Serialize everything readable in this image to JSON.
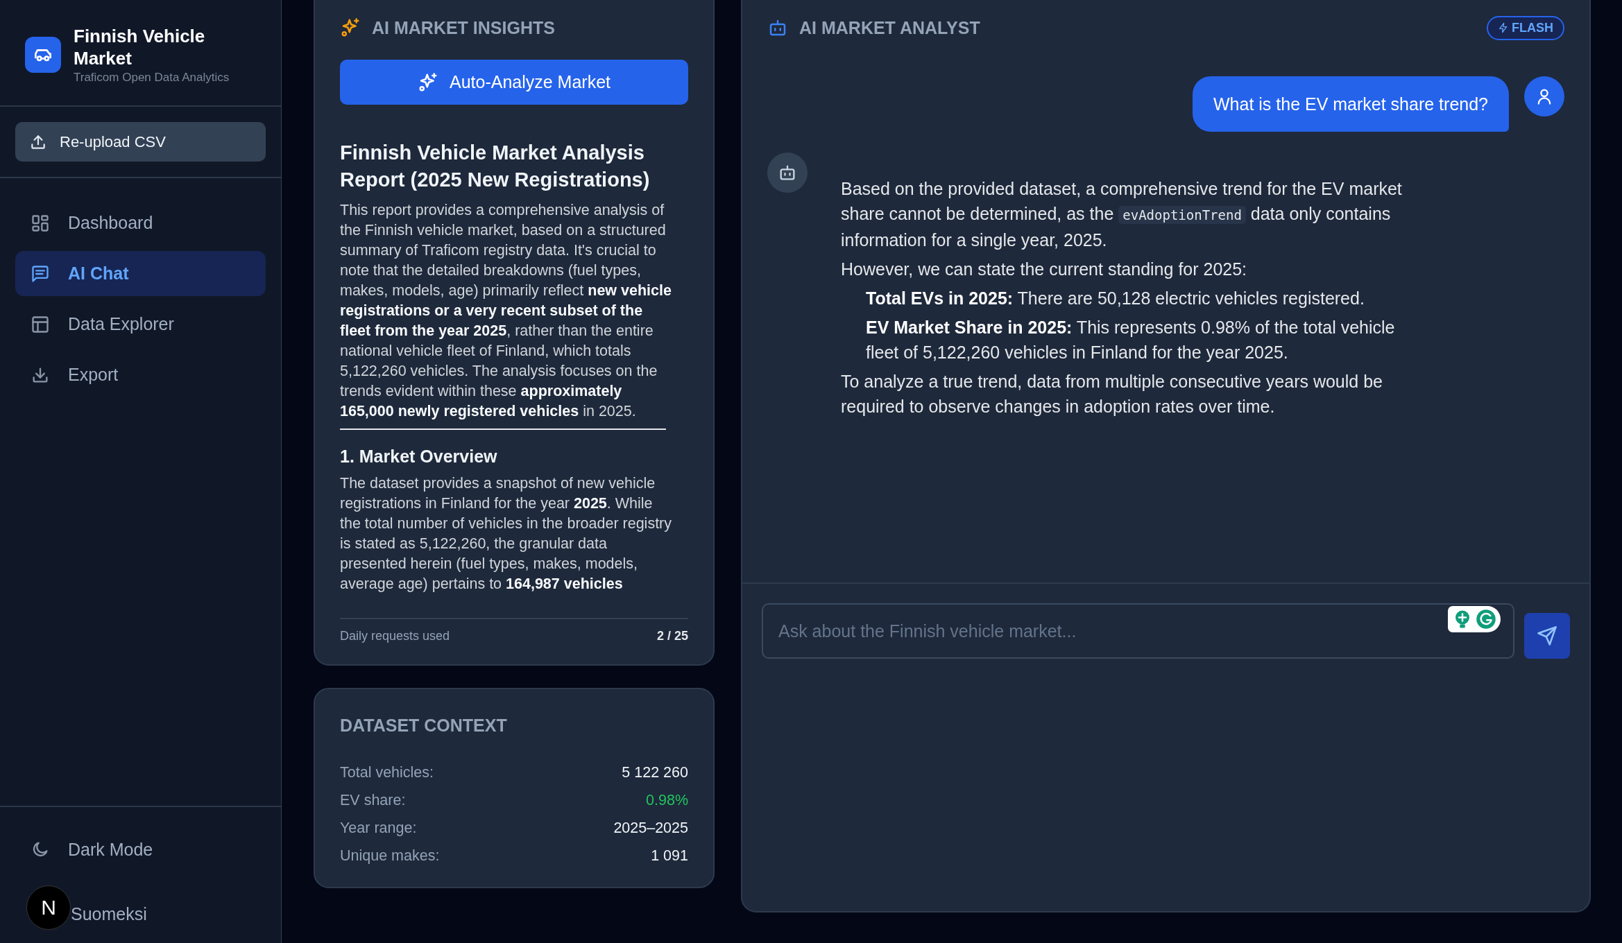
{
  "sidebar": {
    "app_title": "Finnish Vehicle Market",
    "app_subtitle": "Traficom Open Data Analytics",
    "upload_button": "Re-upload CSV",
    "nav_items": [
      {
        "label": "Dashboard",
        "selected": false
      },
      {
        "label": "AI Chat",
        "selected": true
      },
      {
        "label": "Data Explorer",
        "selected": false
      },
      {
        "label": "Export",
        "selected": false
      }
    ],
    "footer_items": [
      {
        "label": "Dark Mode"
      },
      {
        "label": "Suomeksi"
      }
    ]
  },
  "dev_badge": {
    "label": "N"
  },
  "insights": {
    "title": "AI MARKET INSIGHTS",
    "analyze_button": "Auto-Analyze Market",
    "report": [
      {
        "kind": "title",
        "text": "Finnish Vehicle Market Analysis Report (2025 New Registrations)"
      },
      {
        "kind": "paragraph",
        "text": "This report provides a comprehensive analysis of the Finnish vehicle market, based on a structured summary of Traficom registry data. It's crucial to note that the detailed breakdowns (fuel types, makes, models, age) primarily reflect **new vehicle registrations or a very recent subset of the fleet from the year 2025**, rather than the entire national vehicle fleet of Finland, which totals 5,122,260 vehicles. The analysis focuses on the trends evident within these **approximately 165,000 newly registered vehicles** in 2025."
      },
      {
        "kind": "rule"
      },
      {
        "kind": "heading",
        "text": "1. Market Overview"
      },
      {
        "kind": "paragraph",
        "text": "The dataset provides a snapshot of new vehicle registrations in Finland for the year **2025**. While the total number of vehicles in the broader registry is stated as 5,122,260, the granular data presented herein (fuel types, makes, models, average age) pertains to **164,987 vehicles**"
      }
    ],
    "usage_label": "Daily requests used",
    "usage_value": "2 / 25"
  },
  "dataset_context": {
    "title": "DATASET CONTEXT",
    "rows": [
      {
        "label": "Total vehicles:",
        "value": "5 122 260",
        "highlighted": false
      },
      {
        "label": "EV share:",
        "value": "0.98%",
        "highlighted": true
      },
      {
        "label": "Year range:",
        "value": "2025–2025",
        "highlighted": false
      },
      {
        "label": "Unique makes:",
        "value": "1 091",
        "highlighted": false
      }
    ]
  },
  "chat": {
    "title": "AI MARKET ANALYST",
    "mode_badge": "FLASH",
    "messages": [
      {
        "kind": "user",
        "text": "What is the EV market share trend?"
      },
      {
        "kind": "assistant",
        "blocks": [
          {
            "kind": "paragraph",
            "parts": [
              {
                "kind": "text",
                "text": "Based on the provided dataset, a comprehensive trend for the EV market share cannot be determined, as the "
              },
              {
                "kind": "code",
                "text": "evAdoptionTrend"
              },
              {
                "kind": "text",
                "text": " data only contains information for a single year, 2025."
              }
            ]
          },
          {
            "kind": "paragraph",
            "parts": [
              {
                "kind": "text",
                "text": "However, we can state the current standing for 2025:"
              }
            ]
          },
          {
            "kind": "list_item",
            "parts": [
              {
                "kind": "text",
                "text": "**Total EVs in 2025:** There are 50,128 electric vehicles registered."
              }
            ]
          },
          {
            "kind": "list_item",
            "parts": [
              {
                "kind": "text",
                "text": "**EV Market Share in 2025:** This represents 0.98% of the total vehicle fleet of 5,122,260 vehicles in Finland for the year 2025."
              }
            ]
          },
          {
            "kind": "paragraph",
            "parts": [
              {
                "kind": "text",
                "text": "To analyze a true trend, data from multiple consecutive years would be required to observe changes in adoption rates over time."
              }
            ]
          }
        ]
      }
    ],
    "input": {
      "placeholder": "Ask about the Finnish vehicle market..."
    }
  }
}
